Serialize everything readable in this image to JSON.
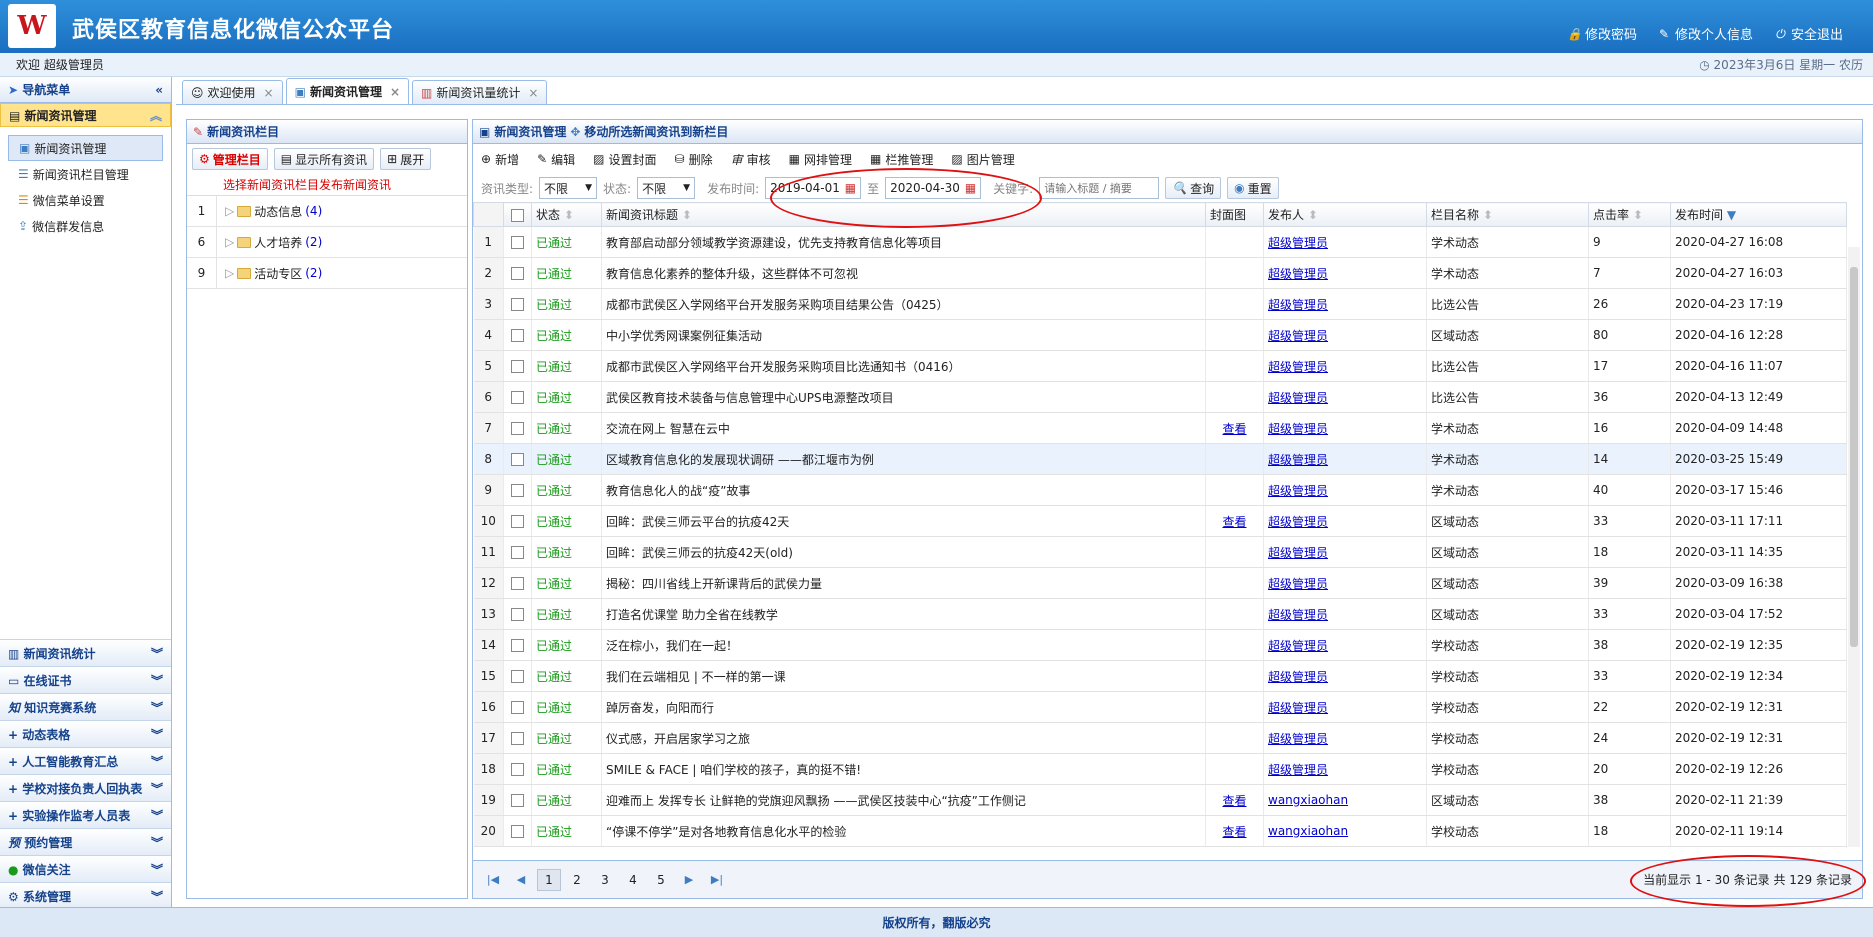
{
  "header": {
    "logo_text": "W",
    "title": "武侯区教育信息化微信公众平台",
    "links": [
      {
        "icon": "lock-icon",
        "label": "修改密码"
      },
      {
        "icon": "edit-user-icon",
        "label": "修改个人信息"
      },
      {
        "icon": "power-icon",
        "label": "安全退出"
      }
    ]
  },
  "welcome": {
    "text": "欢迎 超级管理员",
    "date": "2023年3月6日 星期一 农历"
  },
  "sidebar": {
    "title": "导航菜单",
    "active_group": "新闻资讯管理",
    "sub_items": [
      {
        "label": "新闻资讯管理"
      },
      {
        "label": "新闻资讯栏目管理"
      },
      {
        "label": "微信菜单设置"
      },
      {
        "label": "微信群发信息"
      }
    ],
    "groups": [
      {
        "label": "新闻资讯统计"
      },
      {
        "label": "在线证书"
      },
      {
        "label": "知识竞赛系统"
      },
      {
        "label": "动态表格"
      },
      {
        "label": "人工智能教育汇总"
      },
      {
        "label": "学校对接负责人回执表"
      },
      {
        "label": "实验操作监考人员表"
      },
      {
        "label": "预约管理"
      },
      {
        "label": "微信关注"
      },
      {
        "label": "系统管理"
      }
    ]
  },
  "tabs": [
    {
      "label": "欢迎使用"
    },
    {
      "label": "新闻资讯管理"
    },
    {
      "label": "新闻资讯量统计"
    }
  ],
  "left_panel": {
    "title": "新闻资讯栏目",
    "manage_btn": "管理栏目",
    "show_all_btn": "显示所有资讯",
    "expand_btn": "展开",
    "hint": "选择新闻资讯栏目发布新闻资讯",
    "tree": [
      {
        "num": "1",
        "label": "动态信息",
        "count": "(4)"
      },
      {
        "num": "6",
        "label": "人才培养",
        "count": "(2)"
      },
      {
        "num": "9",
        "label": "活动专区",
        "count": "(2)"
      }
    ]
  },
  "right_panel": {
    "title": "新闻资讯管理",
    "move_label": "移动所选新闻资讯到新栏目",
    "toolbar": [
      "新增",
      "编辑",
      "设置封面",
      "删除",
      "审核",
      "网排管理",
      "栏推管理",
      "图片管理"
    ],
    "filters": {
      "type_label": "资讯类型:",
      "type_value": "不限",
      "status_label": "状态:",
      "status_value": "不限",
      "date_label": "发布时间:",
      "date_from": "2019-04-01",
      "date_sep": "至",
      "date_to": "2020-04-30",
      "kw_label": "关键字:",
      "kw_placeholder": "请输入标题 / 摘要",
      "search_btn": "查询",
      "reset_btn": "重置"
    },
    "columns": [
      "状态",
      "新闻资讯标题",
      "封面图",
      "发布人",
      "栏目名称",
      "点击率",
      "发布时间"
    ],
    "rows": [
      {
        "n": "1",
        "status": "已通过",
        "title": "教育部启动部分领域教学资源建设，优先支持教育信息化等项目",
        "cover": "",
        "author": "超级管理员",
        "column": "学术动态",
        "clicks": "9",
        "time": "2020-04-27 16:08"
      },
      {
        "n": "2",
        "status": "已通过",
        "title": "教育信息化素养的整体升级，这些群体不可忽视",
        "cover": "",
        "author": "超级管理员",
        "column": "学术动态",
        "clicks": "7",
        "time": "2020-04-27 16:03"
      },
      {
        "n": "3",
        "status": "已通过",
        "title": "成都市武侯区入学网络平台开发服务采购项目结果公告（0425）",
        "cover": "",
        "author": "超级管理员",
        "column": "比选公告",
        "clicks": "26",
        "time": "2020-04-23 17:19"
      },
      {
        "n": "4",
        "status": "已通过",
        "title": "中小学优秀网课案例征集活动",
        "cover": "",
        "author": "超级管理员",
        "column": "区域动态",
        "clicks": "80",
        "time": "2020-04-16 12:28"
      },
      {
        "n": "5",
        "status": "已通过",
        "title": "成都市武侯区入学网络平台开发服务采购项目比选通知书（0416）",
        "cover": "",
        "author": "超级管理员",
        "column": "比选公告",
        "clicks": "17",
        "time": "2020-04-16 11:07"
      },
      {
        "n": "6",
        "status": "已通过",
        "title": "武侯区教育技术装备与信息管理中心UPS电源整改项目",
        "cover": "",
        "author": "超级管理员",
        "column": "比选公告",
        "clicks": "36",
        "time": "2020-04-13 12:49"
      },
      {
        "n": "7",
        "status": "已通过",
        "title": "交流在网上 智慧在云中",
        "cover": "查看",
        "author": "超级管理员",
        "column": "学术动态",
        "clicks": "16",
        "time": "2020-04-09 14:48"
      },
      {
        "n": "8",
        "status": "已通过",
        "title": "区域教育信息化的发展现状调研 ——都江堰市为例",
        "cover": "",
        "author": "超级管理员",
        "column": "学术动态",
        "clicks": "14",
        "time": "2020-03-25 15:49"
      },
      {
        "n": "9",
        "status": "已通过",
        "title": "教育信息化人的战“疫”故事",
        "cover": "",
        "author": "超级管理员",
        "column": "学术动态",
        "clicks": "40",
        "time": "2020-03-17 15:46"
      },
      {
        "n": "10",
        "status": "已通过",
        "title": "回眸：武侯三师云平台的抗疫42天",
        "cover": "查看",
        "author": "超级管理员",
        "column": "区域动态",
        "clicks": "33",
        "time": "2020-03-11 17:11"
      },
      {
        "n": "11",
        "status": "已通过",
        "title": "回眸：武侯三师云的抗疫42天(old)",
        "cover": "",
        "author": "超级管理员",
        "column": "区域动态",
        "clicks": "18",
        "time": "2020-03-11 14:35"
      },
      {
        "n": "12",
        "status": "已通过",
        "title": "揭秘：四川省线上开新课背后的武侯力量",
        "cover": "",
        "author": "超级管理员",
        "column": "区域动态",
        "clicks": "39",
        "time": "2020-03-09 16:38"
      },
      {
        "n": "13",
        "status": "已通过",
        "title": "打造名优课堂 助力全省在线教学",
        "cover": "",
        "author": "超级管理员",
        "column": "区域动态",
        "clicks": "33",
        "time": "2020-03-04 17:52"
      },
      {
        "n": "14",
        "status": "已通过",
        "title": "泛在棕小，我们在一起！",
        "cover": "",
        "author": "超级管理员",
        "column": "学校动态",
        "clicks": "38",
        "time": "2020-02-19 12:35"
      },
      {
        "n": "15",
        "status": "已通过",
        "title": "我们在云端相见 | 不一样的第一课",
        "cover": "",
        "author": "超级管理员",
        "column": "学校动态",
        "clicks": "33",
        "time": "2020-02-19 12:34"
      },
      {
        "n": "16",
        "status": "已通过",
        "title": "踔厉奋发，向阳而行",
        "cover": "",
        "author": "超级管理员",
        "column": "学校动态",
        "clicks": "22",
        "time": "2020-02-19 12:31"
      },
      {
        "n": "17",
        "status": "已通过",
        "title": "仪式感，开启居家学习之旅",
        "cover": "",
        "author": "超级管理员",
        "column": "学校动态",
        "clicks": "24",
        "time": "2020-02-19 12:31"
      },
      {
        "n": "18",
        "status": "已通过",
        "title": "SMILE & FACE | 咱们学校的孩子，真的挺不错!",
        "cover": "",
        "author": "超级管理员",
        "column": "学校动态",
        "clicks": "20",
        "time": "2020-02-19 12:26"
      },
      {
        "n": "19",
        "status": "已通过",
        "title": "迎难而上 发挥专长 让鲜艳的党旗迎风飘扬 ——武侯区技装中心“抗疫”工作侧记",
        "cover": "查看",
        "author": "wangxiaohan",
        "column": "区域动态",
        "clicks": "38",
        "time": "2020-02-11 21:39"
      },
      {
        "n": "20",
        "status": "已通过",
        "title": "“停课不停学”是对各地教育信息化水平的检验",
        "cover": "查看",
        "author": "wangxiaohan",
        "column": "学校动态",
        "clicks": "18",
        "time": "2020-02-11 19:14"
      }
    ],
    "pager": {
      "pages": [
        "1",
        "2",
        "3",
        "4",
        "5"
      ],
      "info": "当前显示 1 - 30 条记录 共 129 条记录"
    }
  },
  "footer": "版权所有，翻版必究",
  "colors": {
    "accent": "#1a6fc0",
    "pass": "#1a9a1a",
    "annotation": "#e01010"
  }
}
